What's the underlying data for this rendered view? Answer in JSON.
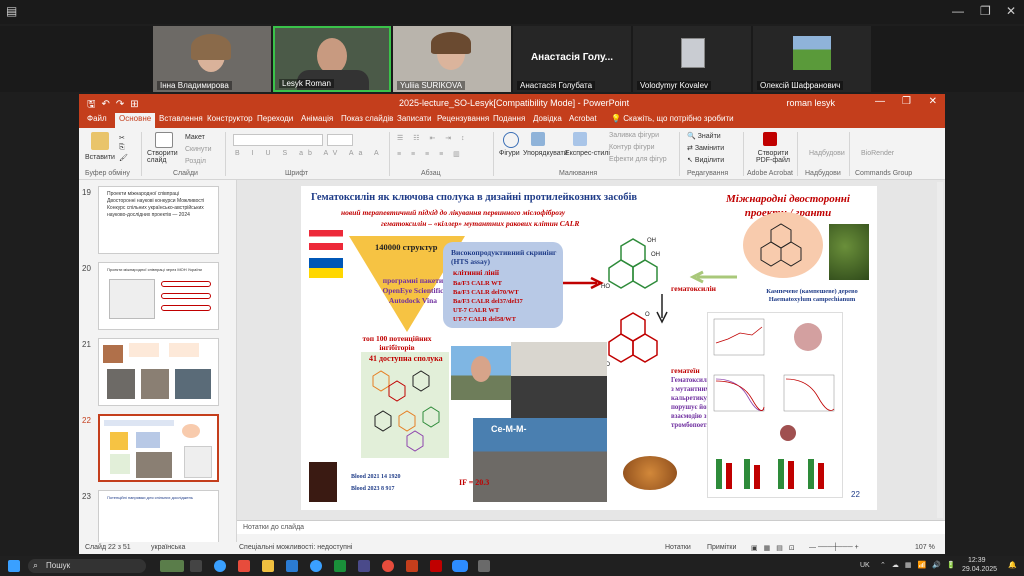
{
  "window_title": "2025-lecture_SO-Lesyk[Compatibility Mode] - PowerPoint",
  "user_name": "roman lesyk",
  "participants": [
    {
      "name": "Інна Владимирова",
      "muted": true
    },
    {
      "name": "Lesyk Roman",
      "muted": true
    },
    {
      "name": "Yuliia SURIKOVA",
      "muted": true
    },
    {
      "name": "Анастасія Голу...",
      "display": "Анастасія Голубата",
      "muted": true
    },
    {
      "name": "Volodymyr Kovalev",
      "muted": true
    },
    {
      "name": "Олексій Шафранович",
      "muted": true
    }
  ],
  "ribbon_tabs": [
    "Файл",
    "Основне",
    "Вставлення",
    "Конструктор",
    "Переходи",
    "Анімація",
    "Показ слайдів",
    "Записати",
    "Рецензування",
    "Подання",
    "Довідка",
    "Acrobat"
  ],
  "ribbon_search": "Скажіть, що потрібно зробити",
  "ribbon": {
    "paste": "Вставити",
    "clipboard_group": "Буфер обміну",
    "new_slide": "Створити слайд",
    "layout": "Макет",
    "reset": "Скинути",
    "section": "Розділ",
    "slides_group": "Слайди",
    "font_group": "Шрифт",
    "paragraph_group": "Абзац",
    "shapes": "Фігури",
    "arrange": "Упорядкувати",
    "quick_styles": "Експрес-стилі",
    "shape_fill": "Заливка фігури",
    "shape_outline": "Контур фігури",
    "shape_effects": "Ефекти для фігур",
    "drawing_group": "Малювання",
    "find": "Знайти",
    "replace": "Замінити",
    "select": "Виділити",
    "editing_group": "Редагування",
    "create_pdf": "Створити PDF-файл",
    "acrobat_group": "Adobe Acrobat",
    "send": "Надбудови",
    "addins_group": "Надбудови",
    "biorender": "BioRender",
    "commands_group": "Commands Group"
  },
  "slides": [
    {
      "num": "19",
      "text": "Проекти міжнародної співпраці Двосторонні наукові конкурси Можливості Конкурс спільних українсько-австрійських науково-дослідних проектів — 2024"
    },
    {
      "num": "20",
      "text": "Проекти міжнародної співпраці через МОН України"
    },
    {
      "num": "21",
      "text": ""
    },
    {
      "num": "22",
      "text": ""
    },
    {
      "num": "23",
      "text": "Потенційні напрямки для спільних досліджень"
    }
  ],
  "slide": {
    "title": "Гематоксилін як ключова сполука в дизайні протилейкозних засобів",
    "subtitle1": "новий терапевтичний підхід до лікування первинного мієлофіброзу",
    "subtitle2": "гематоксилін – «кіллер» мутантних ракових клітин CALR",
    "right_title": "Міжнародні двосторонні проекти / гранти",
    "structures": "140000 структур",
    "programs": "програмні пакети OpenEye Scientific Autodock Vina",
    "top100": "топ 100 потенційних інгібіторів",
    "hts_title": "Високопродуктивний скринінг (HTS assay)",
    "cell_lines_title": "клітинні лінії",
    "cell_lines": [
      "Ba/F3 CALR WT",
      "Ba/F3 CALR del70/WT",
      "Ba/F3 CALR del37/del37",
      "UT-7 CALR WT",
      "UT-7 CALR del58/WT"
    ],
    "compounds": "41 доступна сполука",
    "hematoxylin_label": "гематоксилін",
    "hematein_label": "гематеїн",
    "description": "Гематоксилін зв'язується з мутантним кальретикуліном і порушує його аномальну взаємодію з рецептором тромбопоетину",
    "tree": "Кампечеве (кампешеве) дерево Haematoxylum campechianum",
    "blood1": "Blood 2021 14 1920",
    "blood2": "Blood 2023 8 917",
    "if": "IF = 20.3",
    "page_num": "22",
    "screen_text": "Ce-M-M-"
  },
  "notes_placeholder": "Нотатки до слайда",
  "status": {
    "slide_of": "Слайд 22 з 51",
    "language": "українська",
    "accessibility": "Спеціальні можливості: недоступні",
    "notes": "Нотатки",
    "comments": "Примітки",
    "zoom": "107 %"
  },
  "taskbar": {
    "search": "Пошук",
    "lang": "UK",
    "time": "12:39",
    "date": "29.04.2025"
  },
  "colors": {
    "ppt_accent": "#c43e1c",
    "slide_title": "#1f3c88",
    "slide_red": "#c00000",
    "purple": "#7030a0"
  }
}
